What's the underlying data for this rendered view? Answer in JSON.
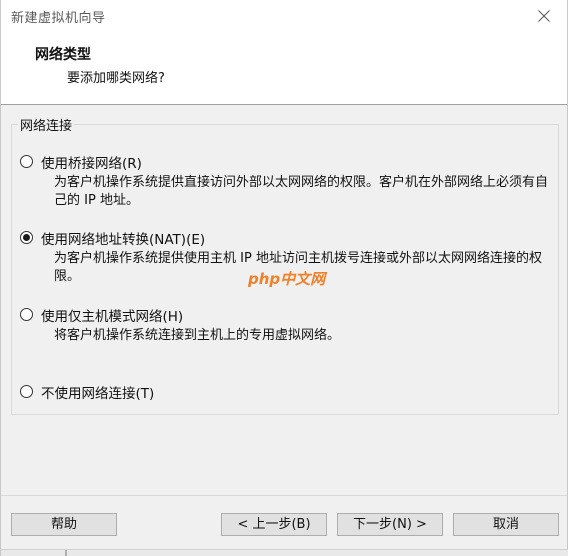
{
  "window": {
    "title": "新建虚拟机向导"
  },
  "header": {
    "title": "网络类型",
    "subtitle": "要添加哪类网络?"
  },
  "group": {
    "legend": "网络连接",
    "options": [
      {
        "label": "使用桥接网络(R)",
        "description": "为客户机操作系统提供直接访问外部以太网网络的权限。客户机在外部网络上必须有自己的 IP 地址。",
        "checked": false
      },
      {
        "label": "使用网络地址转换(NAT)(E)",
        "description": "为客户机操作系统提供使用主机 IP 地址访问主机拨号连接或外部以太网网络连接的权限。",
        "checked": true
      },
      {
        "label": "使用仅主机模式网络(H)",
        "description": "将客户机操作系统连接到主机上的专用虚拟网络。",
        "checked": false
      },
      {
        "label": "不使用网络连接(T)",
        "description": "",
        "checked": false
      }
    ]
  },
  "watermark": {
    "text": "php中文网",
    "color": "#f0812a"
  },
  "buttons": {
    "help": "帮助",
    "back": "< 上一步(B)",
    "next": "下一步(N) >",
    "cancel": "取消"
  },
  "icons": {
    "close": "close-icon"
  }
}
